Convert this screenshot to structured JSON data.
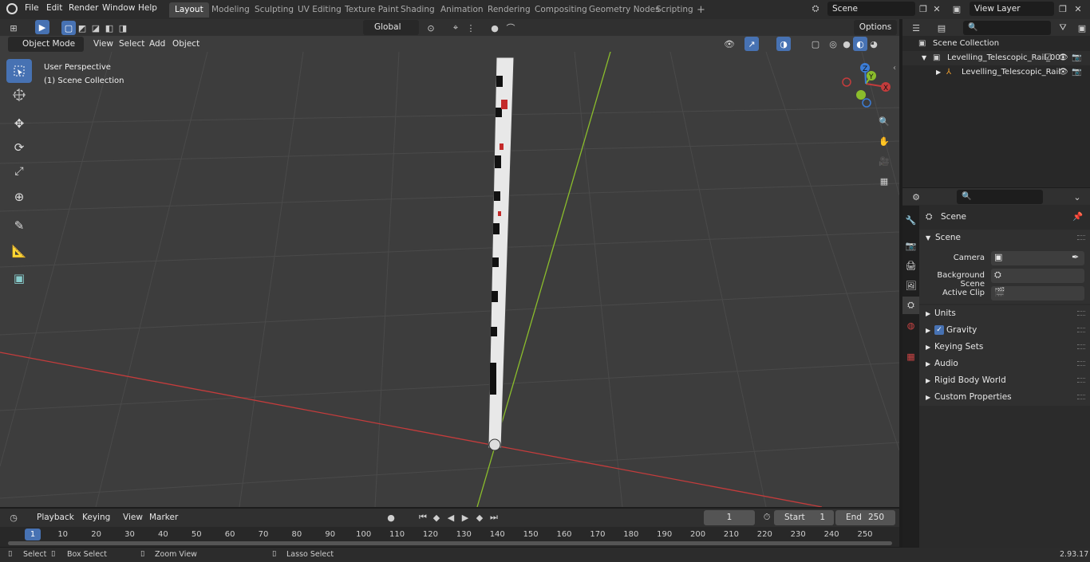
{
  "menubar": {
    "items": [
      "File",
      "Edit",
      "Render",
      "Window",
      "Help"
    ],
    "workspaces": [
      "Layout",
      "Modeling",
      "Sculpting",
      "UV Editing",
      "Texture Paint",
      "Shading",
      "Animation",
      "Rendering",
      "Compositing",
      "Geometry Nodes",
      "Scripting"
    ],
    "active_workspace": "Layout",
    "add_tab": "+",
    "scene_name": "Scene",
    "view_layer": "View Layer"
  },
  "viewport_header": {
    "mode": "Object Mode",
    "menus": [
      "View",
      "Select",
      "Add",
      "Object"
    ],
    "orientation": "Global",
    "options": "Options"
  },
  "viewport": {
    "perspective": "User Perspective",
    "collection": "(1) Scene Collection",
    "gizmo_axes": [
      "X",
      "Y",
      "Z"
    ]
  },
  "outliner": {
    "root": "Scene Collection",
    "collection": "Levelling_Telescopic_Rail_001",
    "object": "Levelling_Telescopic_Rail"
  },
  "properties": {
    "context": "Scene",
    "panel_title": "Scene",
    "fields": [
      {
        "label": "Camera"
      },
      {
        "label": "Background Scene"
      },
      {
        "label": "Active Clip"
      }
    ],
    "subpanels": [
      "Units",
      "Gravity",
      "Keying Sets",
      "Audio",
      "Rigid Body World",
      "Custom Properties"
    ],
    "gravity_checked": true
  },
  "timeline": {
    "menus": [
      "Playback",
      "Keying",
      "View",
      "Marker"
    ],
    "current_frame": "1",
    "start_label": "Start",
    "start": "1",
    "end_label": "End",
    "end": "250",
    "ticks": [
      "1",
      "10",
      "20",
      "30",
      "40",
      "50",
      "60",
      "70",
      "80",
      "90",
      "100",
      "110",
      "120",
      "130",
      "140",
      "150",
      "160",
      "170",
      "180",
      "190",
      "200",
      "210",
      "220",
      "230",
      "240",
      "250"
    ]
  },
  "statusbar": {
    "select": "Select",
    "box_select": "Box Select",
    "zoom_view": "Zoom View",
    "lasso_select": "Lasso Select",
    "version": "2.93.17"
  },
  "colors": {
    "accent": "#4772b3",
    "x_axis": "#c43c3c",
    "y_axis": "#8bbd2c"
  }
}
